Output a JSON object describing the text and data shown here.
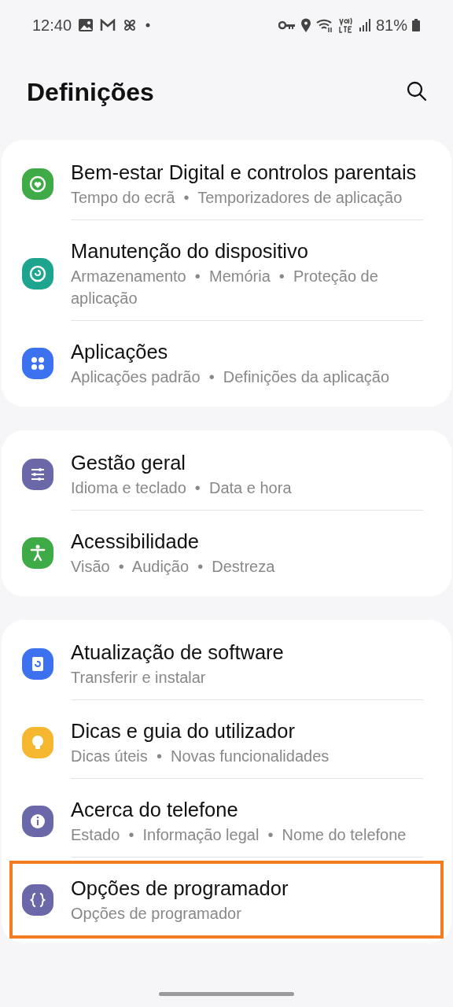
{
  "status_bar": {
    "time": "12:40",
    "battery": "81%"
  },
  "header": {
    "title": "Definições"
  },
  "groups": [
    {
      "items": [
        {
          "kind": "wellbeing",
          "color": "#3fab47",
          "title": "Bem-estar Digital e controlos parentais",
          "subtitle": "Tempo do ecrã  •  Temporizadores de aplicação",
          "highlighted": false
        },
        {
          "kind": "care",
          "color": "#1ea58f",
          "title": "Manutenção do dispositivo",
          "subtitle": "Armazenamento  •  Memória  •  Proteção de aplicação",
          "highlighted": false
        },
        {
          "kind": "apps",
          "color": "#3c72f0",
          "title": "Aplicações",
          "subtitle": "Aplicações padrão  •  Definições da aplicação",
          "highlighted": false
        }
      ]
    },
    {
      "items": [
        {
          "kind": "sliders",
          "color": "#6a68a8",
          "title": "Gestão geral",
          "subtitle": "Idioma e teclado  •  Data e hora",
          "highlighted": false
        },
        {
          "kind": "person",
          "color": "#3fab47",
          "title": "Acessibilidade",
          "subtitle": "Visão  •  Audição  •  Destreza",
          "highlighted": false
        }
      ]
    },
    {
      "items": [
        {
          "kind": "update",
          "color": "#3c72f0",
          "title": "Atualização de software",
          "subtitle": "Transferir e instalar",
          "highlighted": false
        },
        {
          "kind": "bulb",
          "color": "#f5b730",
          "title": "Dicas e guia do utilizador",
          "subtitle": "Dicas úteis  •  Novas funcionalidades",
          "highlighted": false
        },
        {
          "kind": "info",
          "color": "#6a68a8",
          "title": "Acerca do telefone",
          "subtitle": "Estado  •  Informação legal  •  Nome do telefone",
          "highlighted": false
        },
        {
          "kind": "braces",
          "color": "#6a68a8",
          "title": "Opções de programador",
          "subtitle": "Opções de programador",
          "highlighted": true
        }
      ]
    }
  ]
}
